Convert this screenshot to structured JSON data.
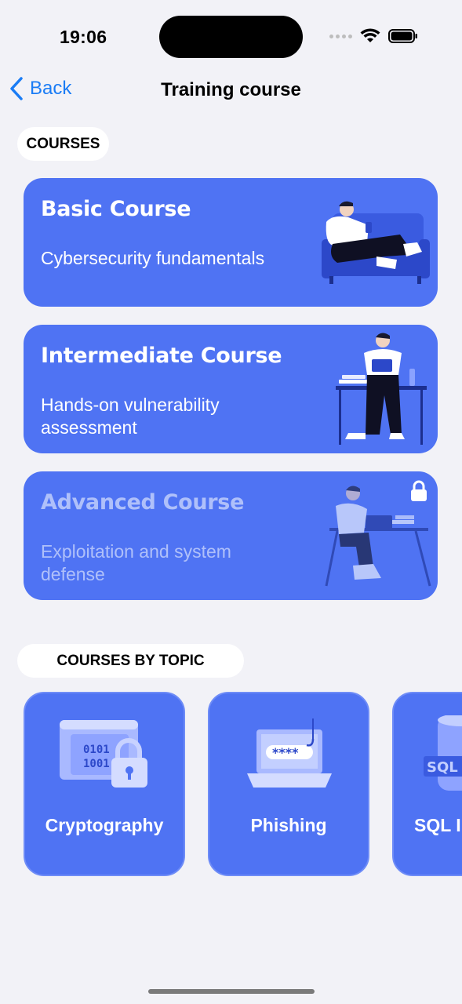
{
  "status": {
    "time": "19:06"
  },
  "nav": {
    "back_label": "Back",
    "title": "Training course"
  },
  "sections": {
    "courses": "COURSES",
    "topics": "COURSES BY TOPIC"
  },
  "courses": [
    {
      "title": "Basic Course",
      "subtitle": "Cybersecurity fundamentals",
      "locked": false
    },
    {
      "title": "Intermediate Course",
      "subtitle": "Hands-on vulnerability assessment",
      "locked": false
    },
    {
      "title": "Advanced Course",
      "subtitle": "Exploitation and system defense",
      "locked": true
    }
  ],
  "topics": [
    {
      "label": "Cryptography"
    },
    {
      "label": "Phishing"
    },
    {
      "label": "SQL I"
    }
  ],
  "icons": {
    "back": "chevron-left-icon",
    "lock": "lock-icon",
    "wifi": "wifi-icon",
    "battery": "battery-icon"
  },
  "colors": {
    "accent": "#1a7cf5",
    "card": "#4f73f3",
    "background": "#f2f2f7"
  }
}
